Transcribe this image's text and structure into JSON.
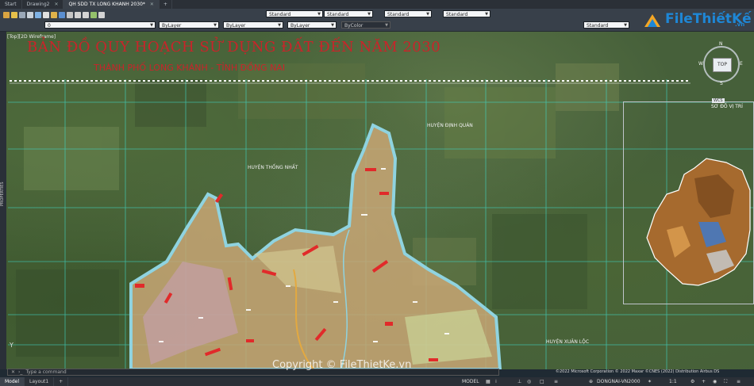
{
  "tabs": [
    {
      "label": "Start",
      "active": false,
      "closable": false
    },
    {
      "label": "Drawing2",
      "active": false,
      "closable": true
    },
    {
      "label": "QH SDD TX LONG KHANH 2030*",
      "active": true,
      "closable": true
    }
  ],
  "ribbon": {
    "text_style": "Standard",
    "dim_style": "Standard",
    "table_style": "Standard",
    "multileader_style": "Standard",
    "layer": "0",
    "color": "ByLayer",
    "linetype": "ByLayer",
    "lineweight": "ByLayer",
    "plotstyle": "ByColor",
    "visual_style": "Standard"
  },
  "viewport_label": "[Top][2D Wireframe]",
  "map": {
    "title": "BẢN ĐỒ QUY HOẠCH SỬ DỤNG ĐẤT ĐẾN NĂM 2030",
    "subtitle": "THÀNH PHỐ LONG KHÁNH - TỈNH ĐỒNG NAI",
    "labels": {
      "dinh_quan": "HUYỆN ĐỊNH QUÁN",
      "thong_nhat": "HUYỆN THỐNG NHẤT",
      "xuan_loc": "HUYỆN XUÂN LỘC",
      "so_do_vi_tri": "SƠ ĐỒ VỊ TRÍ"
    }
  },
  "navcube": {
    "top": "TOP",
    "n": "N",
    "s": "S",
    "e": "E",
    "w": "W",
    "wcs": "WCS"
  },
  "ucs_y": "Y",
  "properties_palette": "PROPERTIES",
  "command": {
    "placeholder": "Type a command"
  },
  "copyright": "©2022 Microsoft Corporation © 2022 Maxar ©CNES (2022) Distribution Airbus DS",
  "watermark": "Copyright © FileThietKe.vn",
  "logo": {
    "name": "FileThiếtKế",
    "domain": ".vn"
  },
  "layout_tabs": [
    "Model",
    "Layout1"
  ],
  "status": {
    "model": "MODEL",
    "coord_system": "DONGNAI-VN2000",
    "annotation_scale": "1:1"
  },
  "colors": {
    "title_red": "#c9242a",
    "boundary_cyan": "#8fd3e0",
    "grid_cyan": "#3fd7c6",
    "landuse_orange": "#c9a776",
    "logo_blue": "#1e87d6"
  }
}
